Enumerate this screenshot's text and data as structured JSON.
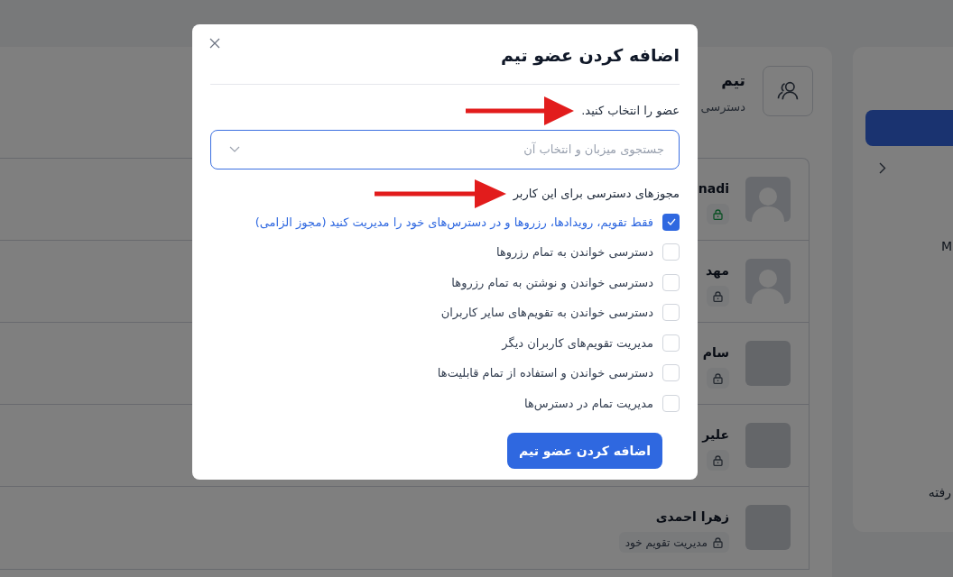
{
  "team": {
    "title": "تیم",
    "subtitle": "دسترسی"
  },
  "members": [
    {
      "name": "nadi",
      "kind": "placeholder",
      "color": "#0b5125"
    },
    {
      "name": "مهد",
      "kind": "placeholder",
      "color": "#252a31"
    },
    {
      "name": "سام",
      "kind": "photo",
      "color": "#252a31"
    },
    {
      "name": "علیر",
      "kind": "photo",
      "color": "#252a31"
    },
    {
      "name": "زهرا احمدی",
      "kind": "photo",
      "color": "#252a31",
      "badge": "مدیریت تقویم خود"
    }
  ],
  "side_panel": {
    "letter": "M",
    "text": "رفته"
  },
  "modal": {
    "title": "اضافه کردن عضو تیم",
    "member_label": "عضو را انتخاب کنید.",
    "member_select": {
      "placeholder": "جستجوی میزبان و انتخاب آن"
    },
    "permissions_label": "مجوزهای دسترسی برای این کاربر",
    "permissions": [
      {
        "label": "فقط تقویم، رویدادها، رزروها و در دسترس‌های خود را مدیریت کنید (مجوز الزامی)",
        "checked": true
      },
      {
        "label": "دسترسی خواندن به تمام رزروها",
        "checked": false
      },
      {
        "label": "دسترسی خواندن و نوشتن به تمام رزروها",
        "checked": false
      },
      {
        "label": "دسترسی خواندن به تقویم‌های سایر کاربران",
        "checked": false
      },
      {
        "label": "مدیریت تقویم‌های کاربران دیگر",
        "checked": false
      },
      {
        "label": "دسترسی خواندن و استفاده از تمام قابلیت‌ها",
        "checked": false
      },
      {
        "label": "مدیریت تمام در دسترس‌ها",
        "checked": false
      }
    ],
    "submit": "اضافه کردن عضو تیم"
  }
}
